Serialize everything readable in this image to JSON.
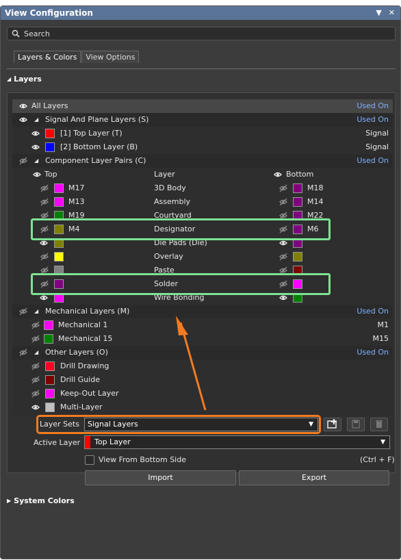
{
  "window": {
    "title": "View Configuration"
  },
  "search": {
    "placeholder": "Search"
  },
  "tabs": [
    {
      "label": "Layers & Colors",
      "active": true
    },
    {
      "label": "View Options",
      "active": false
    }
  ],
  "sections": {
    "layers": "Layers",
    "system_colors": "System Colors"
  },
  "all_layers": {
    "label": "All Layers",
    "used_on": "Used On"
  },
  "signal_group": {
    "label": "Signal And Plane Layers (S)",
    "used_on": "Used On",
    "rows": [
      {
        "name": "[1] Top Layer (T)",
        "type": "Signal",
        "color": "#ff0000"
      },
      {
        "name": "[2] Bottom Layer (B)",
        "type": "Signal",
        "color": "#0000ff"
      }
    ]
  },
  "component_group": {
    "label": "Component Layer Pairs (C)",
    "used_on": "Used On",
    "col_top": "Top",
    "col_layer": "Layer",
    "col_bottom": "Bottom",
    "rows": [
      {
        "top": "M17",
        "layer": "3D Body",
        "bottom": "M18",
        "top_color": "#ff00ff",
        "bottom_color": "#800080",
        "visible": false
      },
      {
        "top": "M13",
        "layer": "Assembly",
        "bottom": "M14",
        "top_color": "#ff00ff",
        "bottom_color": "#800080",
        "visible": false
      },
      {
        "top": "M19",
        "layer": "Courtyard",
        "bottom": "M22",
        "top_color": "#008000",
        "bottom_color": "#800080",
        "visible": false
      },
      {
        "top": "M4",
        "layer": "Designator",
        "bottom": "M6",
        "top_color": "#808000",
        "bottom_color": "#800080",
        "visible": false
      },
      {
        "top": "",
        "layer": "Die Pads (Die)",
        "bottom": "",
        "top_color": "#808000",
        "bottom_color": "#800080",
        "visible": true
      },
      {
        "top": "",
        "layer": "Overlay",
        "bottom": "",
        "top_color": "#ffff00",
        "bottom_color": "#808000",
        "visible": false
      },
      {
        "top": "",
        "layer": "Paste",
        "bottom": "",
        "top_color": "#808080",
        "bottom_color": "#800000",
        "visible": false
      },
      {
        "top": "",
        "layer": "Solder",
        "bottom": "",
        "top_color": "#800080",
        "bottom_color": "#ff00ff",
        "visible": false
      },
      {
        "top": "",
        "layer": "Wire Bonding",
        "bottom": "",
        "top_color": "#ff00ff",
        "bottom_color": "#008000",
        "visible": true
      }
    ]
  },
  "mechanical_group": {
    "label": "Mechanical Layers (M)",
    "used_on": "Used On",
    "rows": [
      {
        "name": "Mechanical 1",
        "type": "M1",
        "color": "#ff00ff"
      },
      {
        "name": "Mechanical 15",
        "type": "M15",
        "color": "#008000"
      }
    ]
  },
  "other_group": {
    "label": "Other Layers (O)",
    "used_on": "Used On",
    "rows": [
      {
        "name": "Drill Drawing",
        "color": "#ff0022",
        "visible": false
      },
      {
        "name": "Drill Guide",
        "color": "#800000",
        "visible": false
      },
      {
        "name": "Keep-Out Layer",
        "color": "#ff00ff",
        "visible": false
      },
      {
        "name": "Multi-Layer",
        "color": "#c0c0c0",
        "visible": true
      }
    ]
  },
  "controls": {
    "layer_sets_label": "Layer Sets",
    "layer_sets_value": "Signal Layers",
    "active_layer_label": "Active Layer",
    "active_layer_value": "Top Layer",
    "active_layer_color": "#ff0000",
    "view_from_bottom": "View From Bottom Side",
    "view_from_bottom_shortcut": "(Ctrl + F)",
    "import": "Import",
    "export": "Export"
  },
  "colors": {
    "highlight": "#7de393",
    "annotation": "#f47b20",
    "link": "#7fb2ff"
  }
}
